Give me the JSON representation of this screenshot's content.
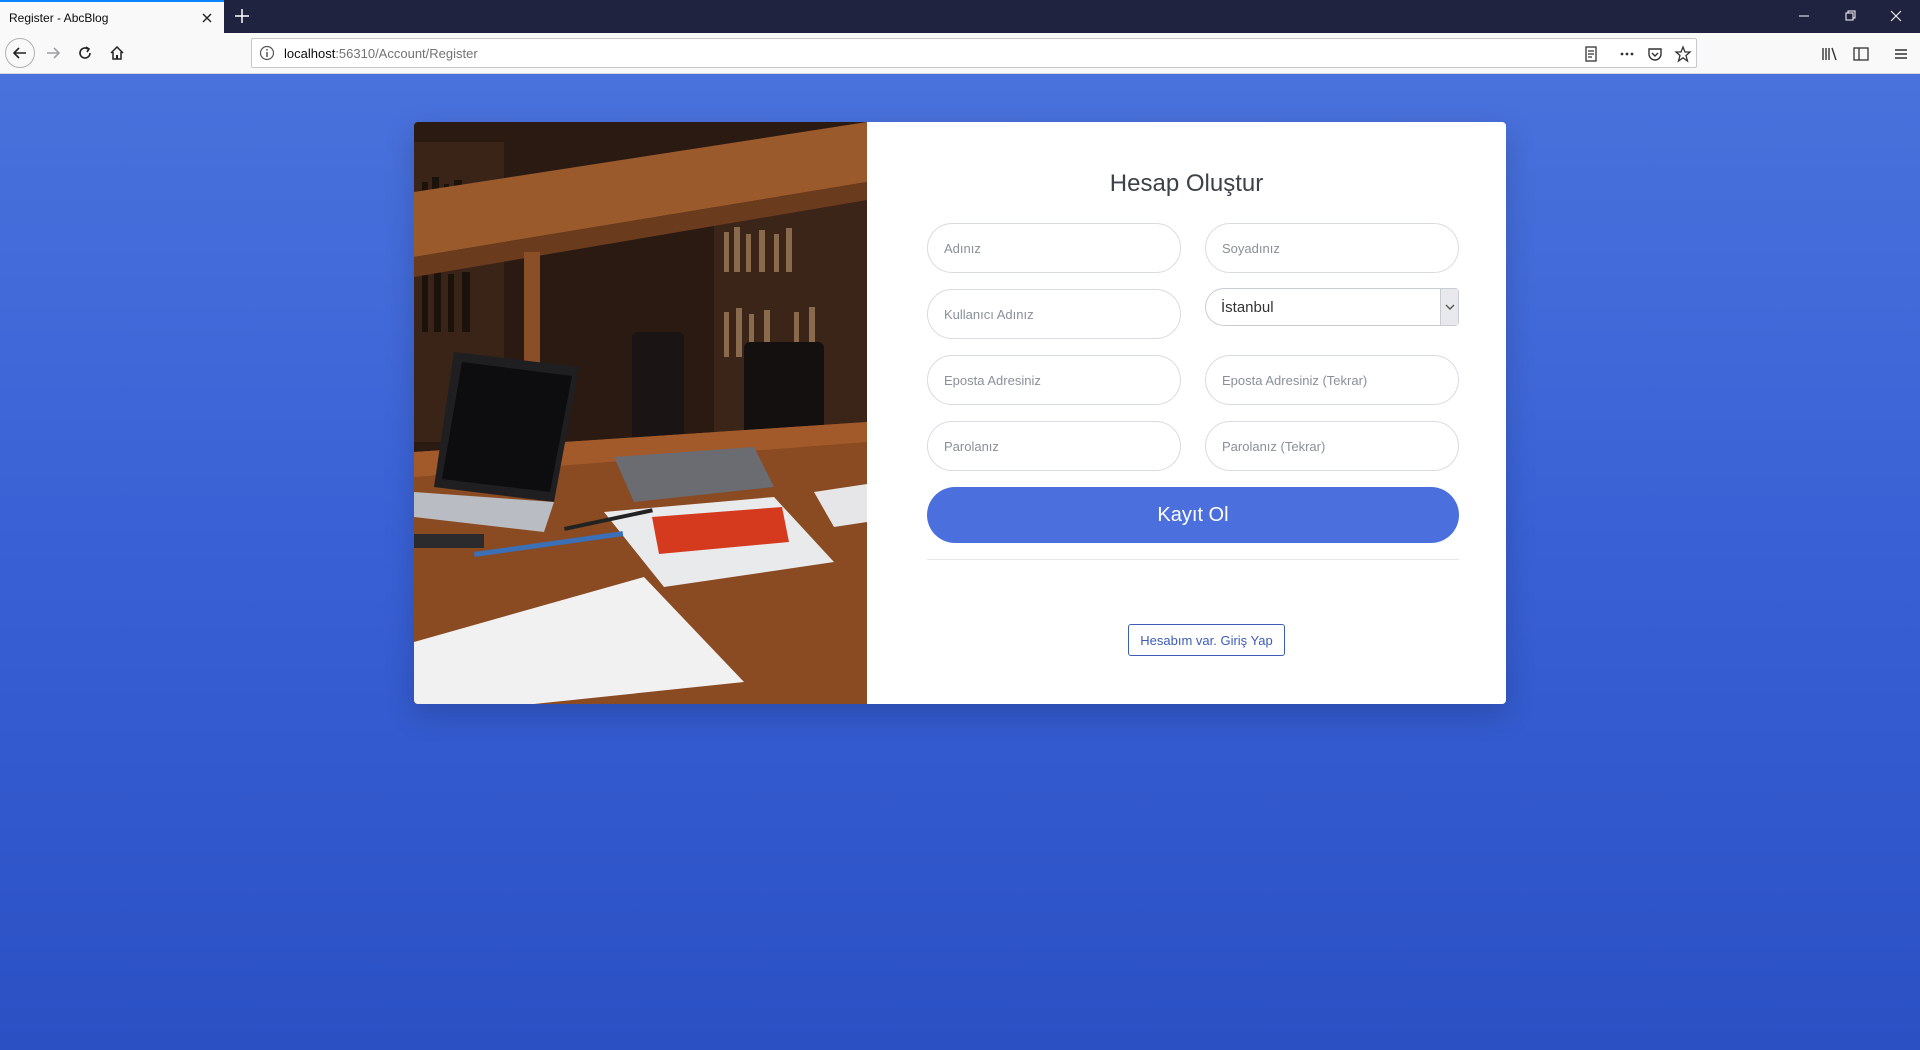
{
  "browser": {
    "tab_title": "Register - AbcBlog",
    "url_host": "localhost",
    "url_rest": ":56310/Account/Register"
  },
  "form": {
    "title": "Hesap Oluştur",
    "first_name_placeholder": "Adınız",
    "last_name_placeholder": "Soyadınız",
    "username_placeholder": "Kullanıcı Adınız",
    "city_selected": "İstanbul",
    "email_placeholder": "Eposta Adresiniz",
    "email_confirm_placeholder": "Eposta Adresiniz (Tekrar)",
    "password_placeholder": "Parolanız",
    "password_confirm_placeholder": "Parolanız (Tekrar)",
    "submit_label": "Kayıt Ol",
    "login_link": "Hesabım var. Giriş Yap"
  },
  "colors": {
    "accent": "#4b6fdc",
    "background_top": "#4a72dc",
    "background_bottom": "#2a50c4",
    "link": "#3d5bb8"
  }
}
